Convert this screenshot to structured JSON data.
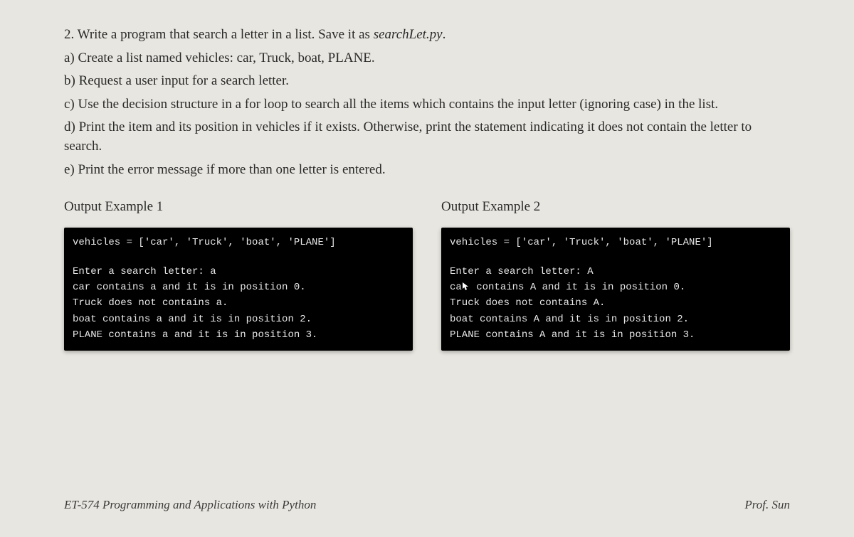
{
  "problem": {
    "intro": "2. Write a program that search a letter in a list.  Save it as ",
    "filename": "searchLet.py",
    "intro_end": ".",
    "a": "a) Create a list named vehicles: car, Truck, boat, PLANE.",
    "b": "b) Request a user input for a search letter.",
    "c": "c) Use the decision structure in a for loop to search all the items which contains the input letter (ignoring case) in the list.",
    "d": "d) Print the item and its position in vehicles if it exists.  Otherwise, print the statement indicating it does not contain the letter to search.",
    "e": "e) Print the error message if more than one letter is entered."
  },
  "example1": {
    "title": "Output Example 1",
    "line_vehicles": "vehicles = ['car', 'Truck', 'boat', 'PLANE']",
    "line_enter": "Enter a search letter: a",
    "line_car": "car contains a and it is in position 0.",
    "line_truck": "Truck does not contains a.",
    "line_boat": "boat contains a and it is in position 2.",
    "line_plane": "PLANE contains a and it is in position 3."
  },
  "example2": {
    "title": "Output Example 2",
    "line_vehicles": "vehicles = ['car', 'Truck', 'boat', 'PLANE']",
    "line_enter": "Enter a search letter: A",
    "line_car_pre": "ca",
    "line_car_post": " contains A and it is in position 0.",
    "line_truck": "Truck does not contains A.",
    "line_boat": "boat contains A and it is in position 2.",
    "line_plane": "PLANE contains A and it is in position 3."
  },
  "footer": {
    "left": "ET-574 Programming and Applications with Python",
    "right": "Prof. Sun"
  }
}
